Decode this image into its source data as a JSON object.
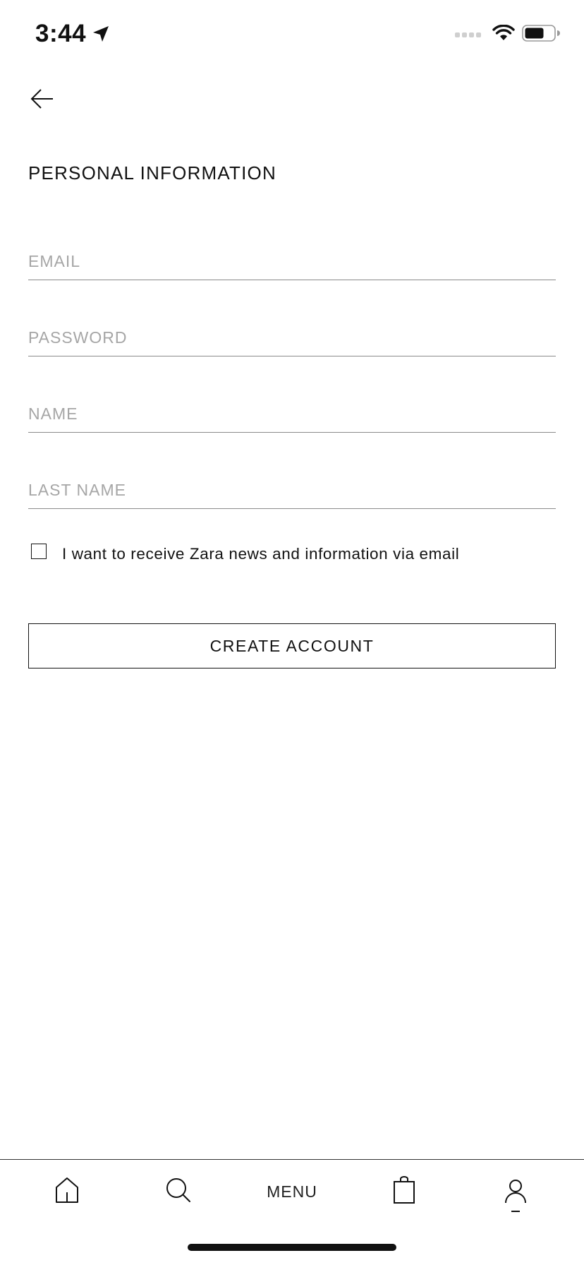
{
  "status_bar": {
    "time": "3:44",
    "icons": [
      "location-arrow-icon",
      "signal-icon",
      "wifi-icon",
      "battery-icon"
    ]
  },
  "header": {
    "back_icon": "arrow-left-icon"
  },
  "form": {
    "title": "PERSONAL INFORMATION",
    "fields": [
      {
        "name": "email",
        "placeholder": "EMAIL",
        "value": ""
      },
      {
        "name": "password",
        "placeholder": "PASSWORD",
        "value": ""
      },
      {
        "name": "name",
        "placeholder": "NAME",
        "value": ""
      },
      {
        "name": "last_name",
        "placeholder": "LAST NAME",
        "value": ""
      }
    ],
    "newsletter_label": "I want to receive Zara news and information via email",
    "newsletter_checked": false,
    "submit_label": "CREATE ACCOUNT"
  },
  "tab_bar": {
    "items": [
      {
        "icon": "home-icon"
      },
      {
        "icon": "search-icon"
      },
      {
        "label": "MENU"
      },
      {
        "icon": "shopping-bag-icon"
      },
      {
        "icon": "user-icon",
        "active": true
      }
    ]
  },
  "colors": {
    "text": "#111111",
    "placeholder": "#a6a6a6",
    "divider": "#8a8a8a",
    "background": "#ffffff"
  }
}
